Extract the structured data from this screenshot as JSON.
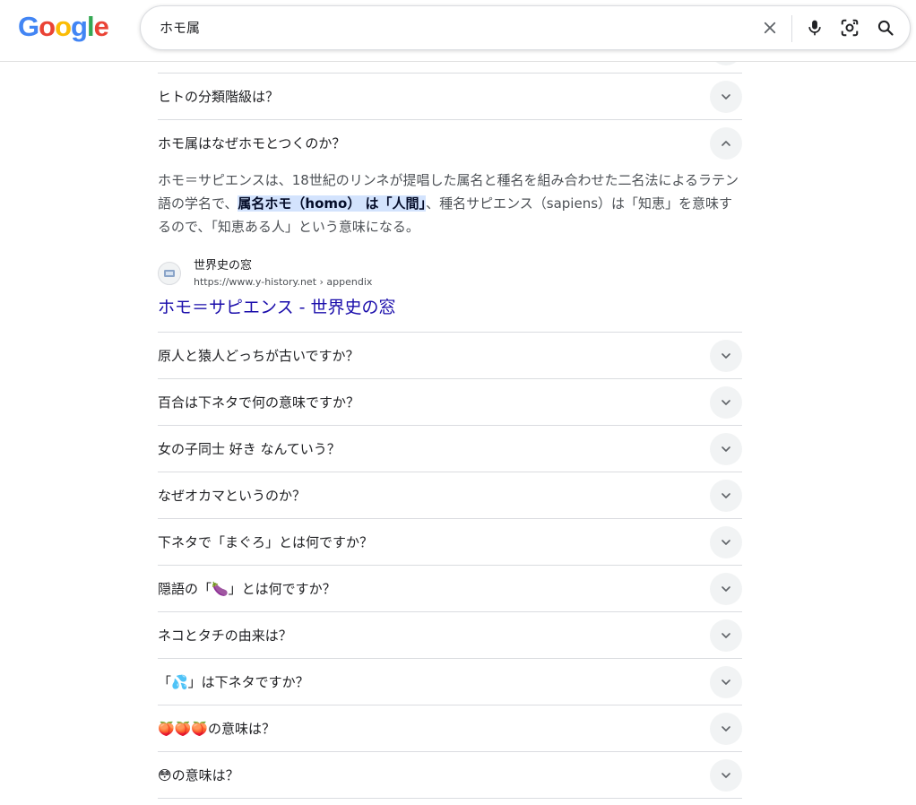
{
  "header": {
    "logo_letters": [
      "G",
      "o",
      "o",
      "g",
      "l",
      "e"
    ],
    "logo_colors": [
      "#4285F4",
      "#EA4335",
      "#FBBC05",
      "#4285F4",
      "#34A853",
      "#EA4335"
    ],
    "search_value": "ホモ属"
  },
  "faq_above": [
    {
      "question": "ヒトの分類階級は？"
    }
  ],
  "expanded": {
    "question": "ホモ属はなぜホモとつくのか？",
    "answer_pre": "ホモ＝サピエンスは、18世紀のリンネが提唱した属名と種名を組み合わせた二名法によるラテン語の学名で、",
    "answer_highlight": "属名ホモ（homo） は「人間」",
    "answer_post": "、種名サピエンス（sapiens）は「知恵」を意味するので、「知恵ある人」という意味になる。",
    "source_name": "世界史の窓",
    "source_url": "https://www.y-history.net › appendix",
    "result_title": "ホモ＝サピエンス - 世界史の窓"
  },
  "faq_below": [
    {
      "question": "原人と猿人どっちが古いですか？"
    },
    {
      "question": "百合は下ネタで何の意味ですか？"
    },
    {
      "question": "女の子同士 好き なんていう？"
    },
    {
      "question": "なぜオカマというのか？"
    },
    {
      "question": "下ネタで「まぐろ」とは何ですか？"
    },
    {
      "question": "隠語の「🍆」とは何ですか？"
    },
    {
      "question": "ネコとタチの由来は？"
    },
    {
      "question": "「💦」は下ネタですか？"
    },
    {
      "question": "🍑🍑🍑の意味は？"
    },
    {
      "question": "😳の意味は？"
    }
  ]
}
